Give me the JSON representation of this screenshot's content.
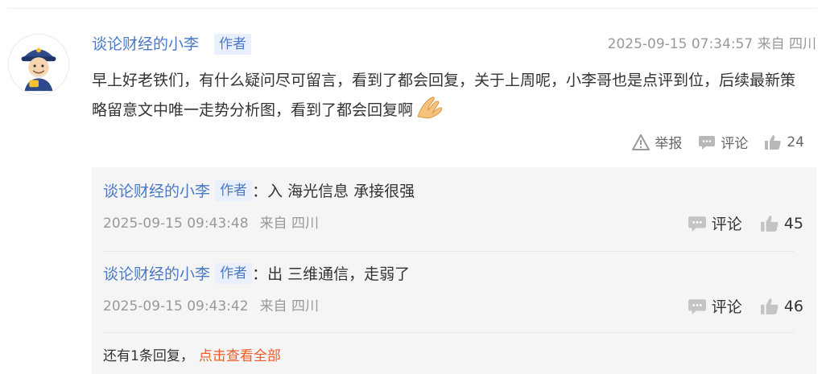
{
  "comment": {
    "author": "谈论财经的小李",
    "badge": "作者",
    "timestamp": "2025-09-15 07:34:57",
    "location": "来自 四川",
    "content": "早上好老铁们，有什么疑问尽可留言，看到了都会回复，关于上周呢，小李哥也是点评到位，后续最新策略留意文中唯一走势分析图，看到了都会回复啊",
    "actions": {
      "report": "举报",
      "comment": "评论",
      "likes": "24"
    }
  },
  "replies": [
    {
      "author": "谈论财经的小李",
      "badge": "作者",
      "text": "：入 海光信息 承接很强",
      "timestamp": "2025-09-15 09:43:48",
      "location": "来自 四川",
      "comment_label": "评论",
      "likes": "45"
    },
    {
      "author": "谈论财经的小李",
      "badge": "作者",
      "text": "：出 三维通信，走弱了",
      "timestamp": "2025-09-15 09:43:42",
      "location": "来自 四川",
      "comment_label": "评论",
      "likes": "46"
    }
  ],
  "more_replies": {
    "text": "还有1条回复，",
    "link": "点击查看全部"
  },
  "icons": [
    "avatar-cartoon",
    "report-warning-icon",
    "comment-bubble-icon",
    "thumbs-up-icon",
    "praying-hands-emoji"
  ],
  "colors": {
    "author": "#4b79c8",
    "badge_bg": "#e9f0fb",
    "link": "#f05a24",
    "reply_bg": "#f5f5f5"
  }
}
